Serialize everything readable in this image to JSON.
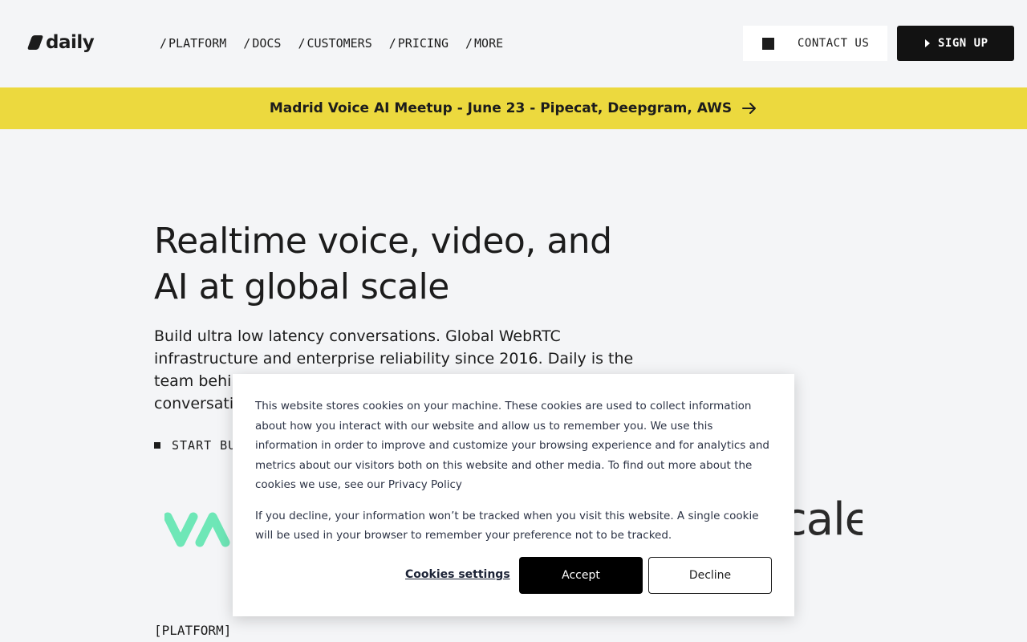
{
  "brand": {
    "name": "daily"
  },
  "nav": {
    "items": [
      {
        "label": "PLATFORM"
      },
      {
        "label": "DOCS"
      },
      {
        "label": "CUSTOMERS"
      },
      {
        "label": "PRICING"
      },
      {
        "label": "MORE"
      }
    ],
    "slash": "/"
  },
  "header": {
    "contact_label": "CONTACT US",
    "signup_label": "SIGN UP"
  },
  "banner": {
    "text": "Madrid Voice AI Meetup - June 23 - Pipecat, Deepgram, AWS"
  },
  "hero": {
    "title_line1": "Realtime voice, video, and",
    "title_line2": "AI at global scale",
    "subtitle_line1": "Build ultra low latency conversations. Global WebRTC",
    "subtitle_line2": "infrastructure and enterprise reliability since 2016. Daily is the",
    "subtitle_line3": "team behi",
    "subtitle_line4": "conversati",
    "cta_label": "START BU"
  },
  "logos": {
    "scale_text": "cale"
  },
  "section": {
    "platform_label": "[PLATFORM]"
  },
  "cookie": {
    "text1": "This website stores cookies on your machine. These cookies are used to collect information about how you interact with our website and allow us to remember you. We use this information in order to improve and customize your browsing experience and for analytics and metrics about our visitors both on this website and other media. To find out more about the cookies we use, see our ",
    "privacy_link": "Privacy Policy",
    "text2": "If you decline, your information won’t be tracked when you visit this website. A single cookie will be used in your browser to remember your preference not to be tracked.",
    "settings_label": "Cookies settings",
    "accept_label": "Accept",
    "decline_label": "Decline"
  },
  "colors": {
    "banner": "#ecd93e",
    "page_bg": "#f4f5f7",
    "dark": "#121212",
    "logo_green": "#6ee7b7"
  }
}
